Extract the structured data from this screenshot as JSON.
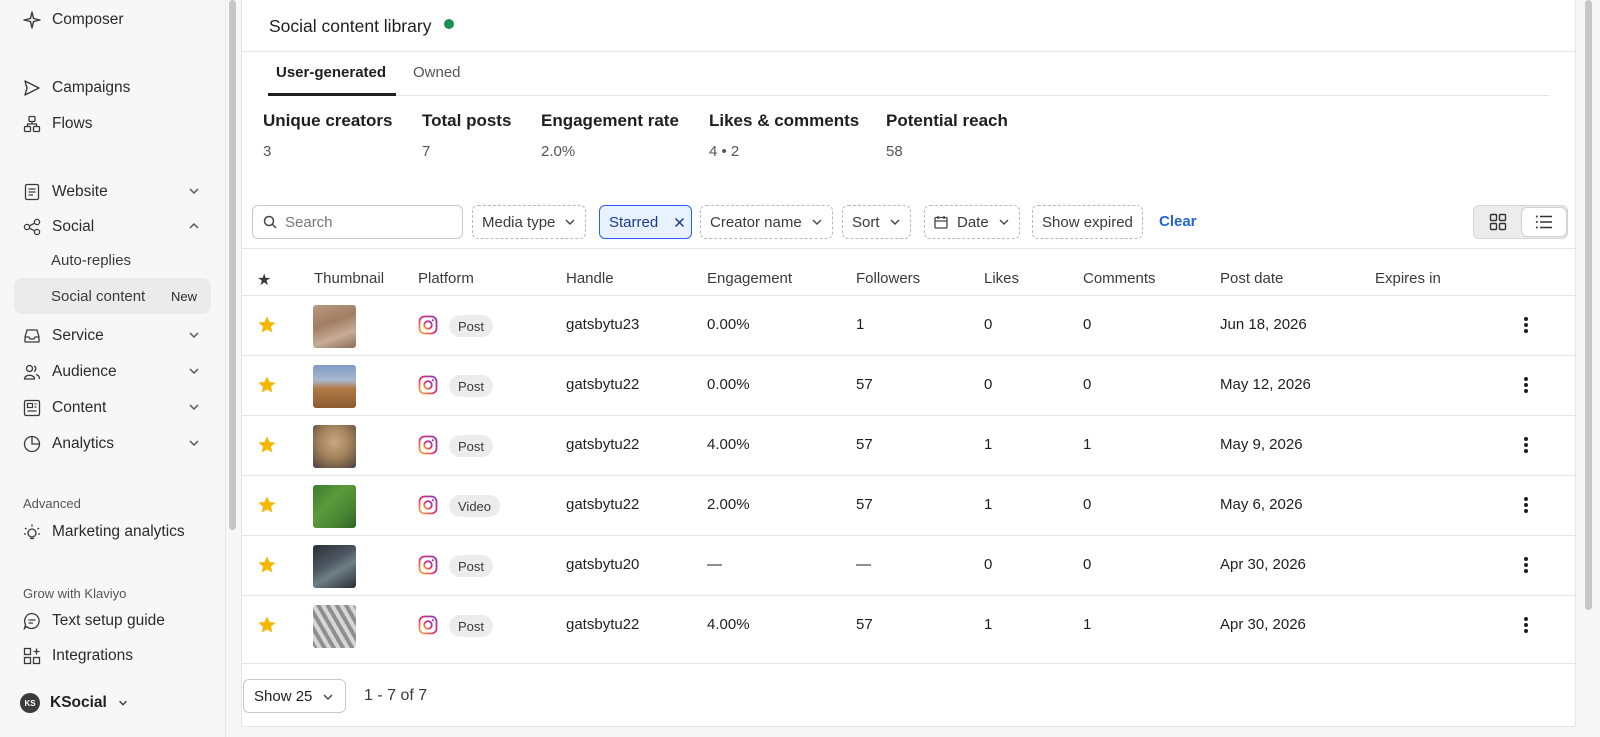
{
  "sidebar": {
    "items": [
      {
        "label": "Composer",
        "icon": "sparkle-icon"
      },
      {
        "label": "Campaigns",
        "icon": "send-icon"
      },
      {
        "label": "Flows",
        "icon": "flows-icon"
      },
      {
        "label": "Website",
        "icon": "document-icon"
      },
      {
        "label": "Social",
        "icon": "share-icon"
      },
      {
        "label": "Service",
        "icon": "inbox-icon"
      },
      {
        "label": "Audience",
        "icon": "users-icon"
      },
      {
        "label": "Content",
        "icon": "content-icon"
      },
      {
        "label": "Analytics",
        "icon": "pie-chart-icon"
      }
    ],
    "social_sub": [
      {
        "label": "Auto-replies"
      },
      {
        "label": "Social content",
        "badge": "New"
      }
    ],
    "advanced_label": "Advanced",
    "marketing_analytics": "Marketing analytics",
    "grow_label": "Grow with Klaviyo",
    "text_setup_guide": "Text setup guide",
    "integrations": "Integrations",
    "account": {
      "initials": "KS",
      "name": "KSocial"
    }
  },
  "header": {
    "title": "Social content library",
    "status_color": "#1a8f54"
  },
  "tabs": [
    {
      "label": "User-generated",
      "active": true
    },
    {
      "label": "Owned",
      "active": false
    }
  ],
  "stats": [
    {
      "label": "Unique creators",
      "value": "3"
    },
    {
      "label": "Total posts",
      "value": "7"
    },
    {
      "label": "Engagement rate",
      "value": "2.0%"
    },
    {
      "label": "Likes & comments",
      "value": "4 • 2"
    },
    {
      "label": "Potential reach",
      "value": "58"
    }
  ],
  "filters": {
    "search_placeholder": "Search",
    "media_type": "Media type",
    "starred": "Starred",
    "creator_name": "Creator name",
    "sort": "Sort",
    "date": "Date",
    "show_expired": "Show expired",
    "clear": "Clear"
  },
  "table": {
    "headers": {
      "star": "★",
      "thumbnail": "Thumbnail",
      "platform": "Platform",
      "handle": "Handle",
      "engagement": "Engagement",
      "followers": "Followers",
      "likes": "Likes",
      "comments": "Comments",
      "post_date": "Post date",
      "expires_in": "Expires in"
    },
    "rows": [
      {
        "type": "Post",
        "handle": "gatsbytu23",
        "engagement": "0.00%",
        "followers": "1",
        "likes": "0",
        "comments": "0",
        "post_date": "Jun 18, 2026"
      },
      {
        "type": "Post",
        "handle": "gatsbytu22",
        "engagement": "0.00%",
        "followers": "57",
        "likes": "0",
        "comments": "0",
        "post_date": "May 12, 2026"
      },
      {
        "type": "Post",
        "handle": "gatsbytu22",
        "engagement": "4.00%",
        "followers": "57",
        "likes": "1",
        "comments": "1",
        "post_date": "May 9, 2026"
      },
      {
        "type": "Video",
        "handle": "gatsbytu22",
        "engagement": "2.00%",
        "followers": "57",
        "likes": "1",
        "comments": "0",
        "post_date": "May 6, 2026"
      },
      {
        "type": "Post",
        "handle": "gatsbytu20",
        "engagement": "—",
        "followers": "—",
        "likes": "0",
        "comments": "0",
        "post_date": "Apr 30, 2026"
      },
      {
        "type": "Post",
        "handle": "gatsbytu22",
        "engagement": "4.00%",
        "followers": "57",
        "likes": "1",
        "comments": "1",
        "post_date": "Apr 30, 2026"
      }
    ]
  },
  "pagination": {
    "page_size": "Show 25",
    "range": "1 - 7 of 7"
  },
  "colors": {
    "star": "#f5b800",
    "accent": "#2266cc",
    "starred_bg": "#e8f1ff"
  }
}
